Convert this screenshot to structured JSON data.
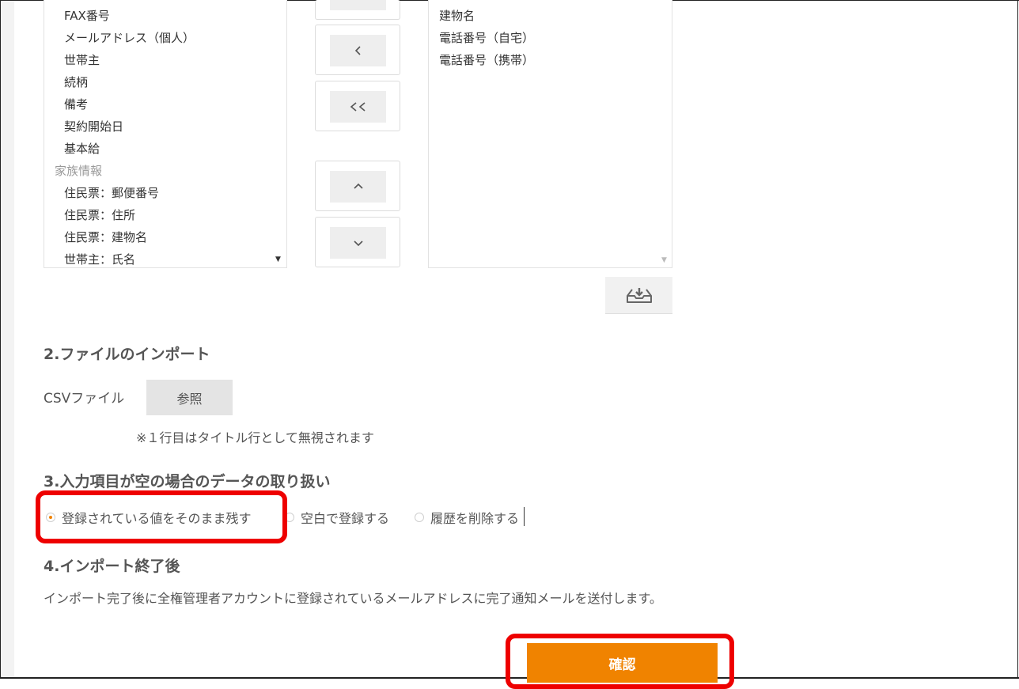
{
  "field_mapping": {
    "available_items": [
      {
        "label": "FAX番号",
        "group": false
      },
      {
        "label": "メールアドレス（個人）",
        "group": false
      },
      {
        "label": "世帯主",
        "group": false
      },
      {
        "label": "続柄",
        "group": false
      },
      {
        "label": "備考",
        "group": false
      },
      {
        "label": "契約開始日",
        "group": false
      },
      {
        "label": "基本給",
        "group": false
      },
      {
        "label": "家族情報",
        "group": true
      },
      {
        "label": "住民票：郵便番号",
        "group": false
      },
      {
        "label": "住民票：住所",
        "group": false
      },
      {
        "label": "住民票：建物名",
        "group": false
      },
      {
        "label": "世帯主：氏名",
        "group": false
      }
    ],
    "selected_items": [
      "建物名",
      "電話番号（自宅）",
      "電話番号（携帯）"
    ],
    "move_buttons": [
      "<",
      "<<",
      "^",
      "v"
    ]
  },
  "section2": {
    "title": "2.ファイルのインポート",
    "csv_label": "CSVファイル",
    "browse_label": "参照",
    "note": "※１行目はタイトル行として無視されます"
  },
  "section3": {
    "title": "3.入力項目が空の場合のデータの取り扱い",
    "options": [
      {
        "label": "登録されている値をそのまま残す",
        "checked": true
      },
      {
        "label": "空白で登録する",
        "checked": false
      },
      {
        "label": "履歴を削除する",
        "checked": false
      }
    ]
  },
  "section4": {
    "title": "4.インポート終了後",
    "description": "インポート完了後に全権管理者アカウントに登録されているメールアドレスに完了通知メールを送付します。"
  },
  "confirm_label": "確認",
  "icons": {
    "export": "download-tray-icon",
    "scroll_down": "scroll-down-arrow-icon"
  },
  "colors": {
    "accent": "#f08300",
    "highlight": "#ee0000",
    "group_text": "#999999"
  }
}
